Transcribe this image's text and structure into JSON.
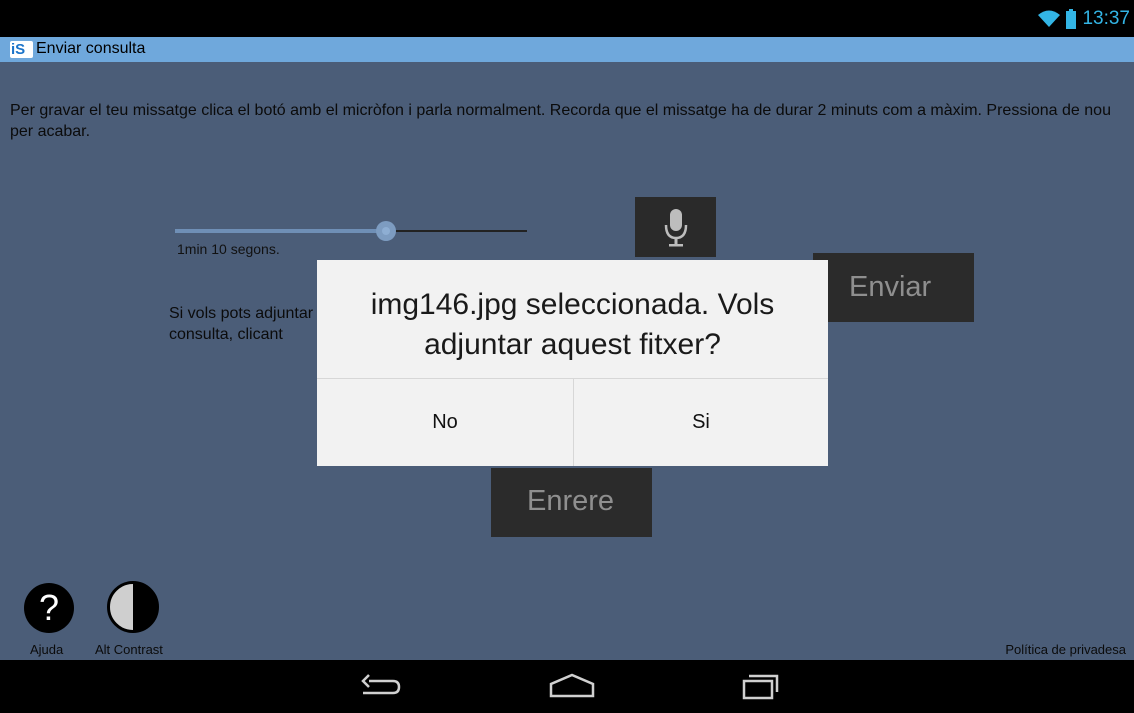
{
  "status": {
    "time": "13:37",
    "icons": [
      "wifi-icon",
      "battery-icon"
    ]
  },
  "app": {
    "title": "Enviar consulta",
    "logo_text": "iS"
  },
  "main": {
    "intro": "Per gravar el teu missatge clica el botó amb el micròfon i parla normalment. Recorda que el missatge ha de durar  2 minuts com a màxim. Pressiona de nou per acabar.",
    "recording": {
      "duration_label": "1min 10 segons.",
      "progress_fraction": 0.6
    },
    "mic_icon": "microphone-icon",
    "send_label": "Enviar",
    "attach_text_line1": "Si vols pots adjuntar",
    "attach_text_line2": "consulta, clicant",
    "back_label": "Enrere"
  },
  "footer": {
    "help_symbol": "?",
    "help_label": "Ajuda",
    "contrast_label": "Alt Contrast",
    "privacy_label": "Política de privadesa"
  },
  "dialog": {
    "message": "img146.jpg seleccionada. Vols adjuntar aquest fitxer?",
    "no_label": "No",
    "yes_label": "Si"
  },
  "colors": {
    "content_bg": "#4b5d78",
    "titlebar_bg": "#6fa8dc",
    "status_accent": "#33b5e5",
    "dialog_bg": "#f2f2f2"
  },
  "navbar": {
    "icons": [
      "back-icon",
      "home-icon",
      "recent-apps-icon"
    ]
  }
}
